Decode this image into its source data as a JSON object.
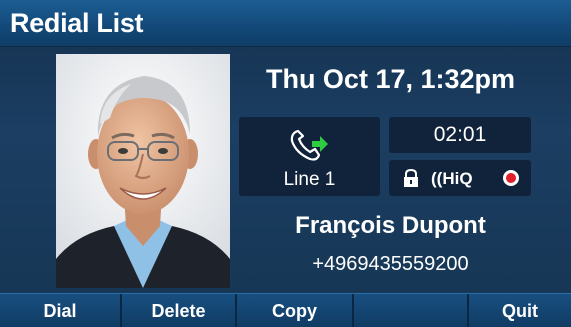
{
  "header": {
    "title": "Redial List"
  },
  "call": {
    "datetime": "Thu Oct 17, 1:32pm",
    "line_label": "Line 1",
    "duration": "02:01",
    "status_icons": [
      "lock-icon",
      "hiq-icon",
      "record-icon"
    ],
    "hiq_label": "((HiQ",
    "caller_name": "François Dupont",
    "caller_number": "+4969435559200"
  },
  "softkeys": [
    "Dial",
    "Delete",
    "Copy",
    "",
    "Quit"
  ],
  "colors": {
    "accent_green": "#2ecc40",
    "record_red": "#e0202a",
    "title_bar": "#134a7a"
  }
}
